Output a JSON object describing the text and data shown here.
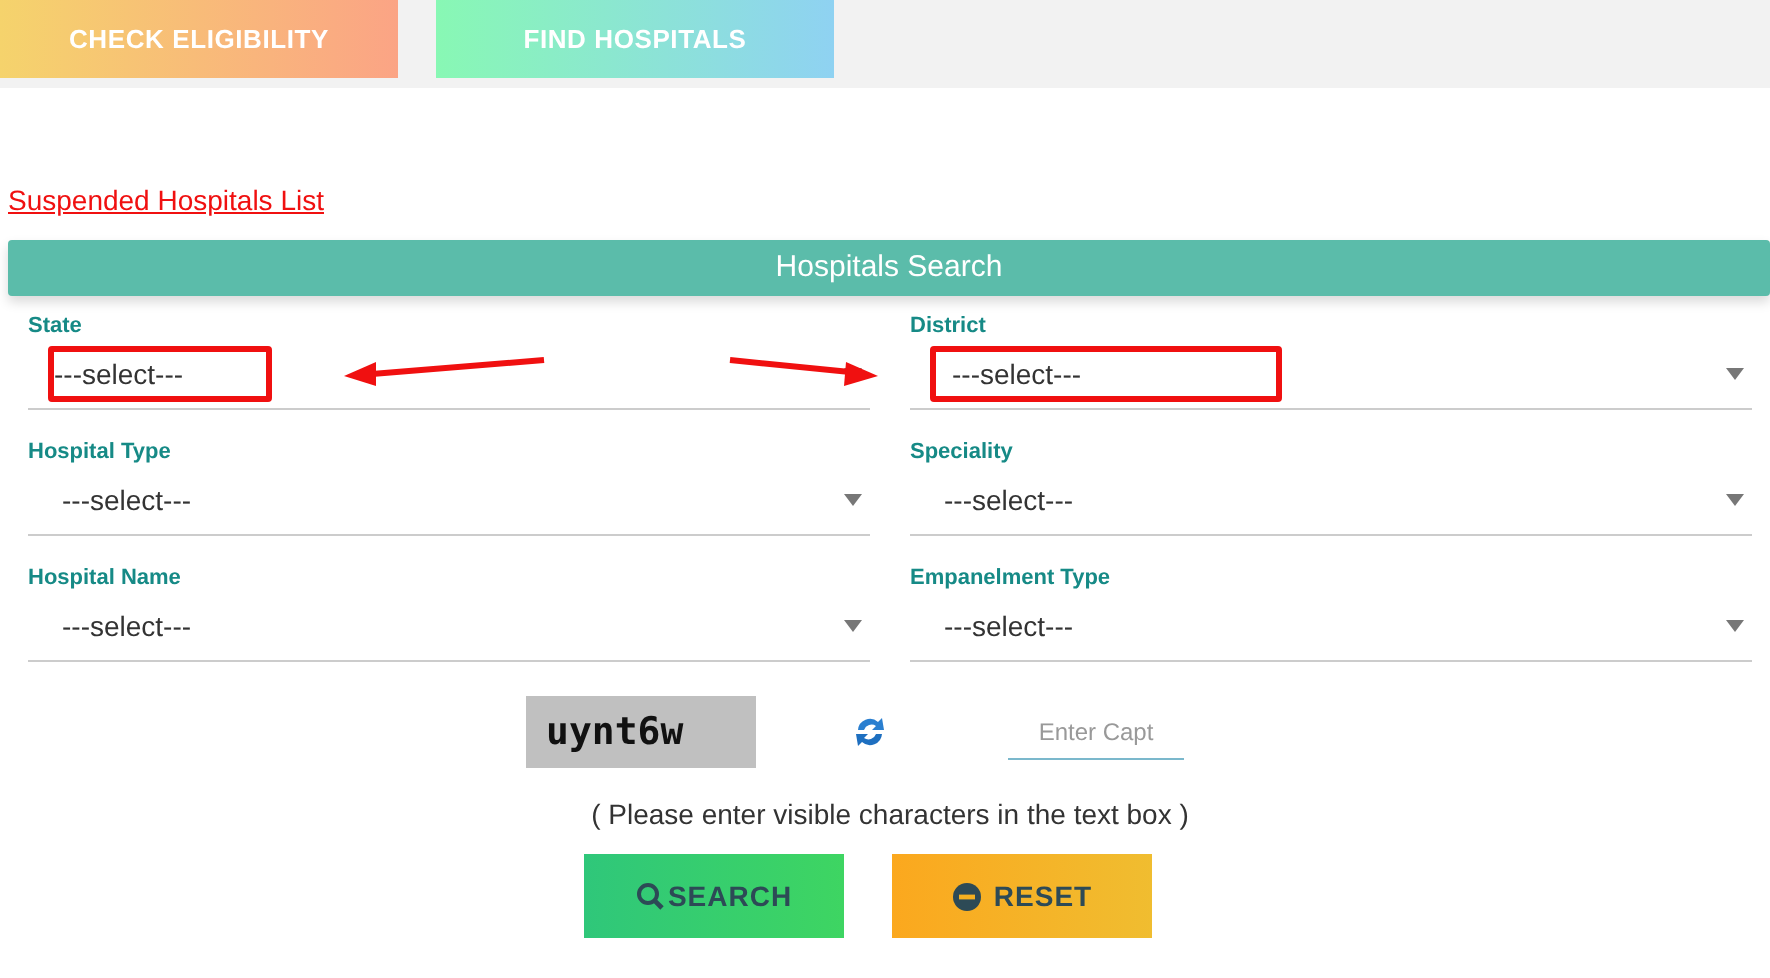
{
  "tabs": [
    {
      "label": "CHECK ELIGIBILITY",
      "kind": "warm"
    },
    {
      "label": "FIND HOSPITALS",
      "kind": "cool"
    }
  ],
  "link": "Suspended Hospitals List",
  "panel_title": "Hospitals Search",
  "fields": [
    {
      "label": "State",
      "value": "---select---",
      "highlighted": true
    },
    {
      "label": "District",
      "value": "---select---",
      "highlighted": true
    },
    {
      "label": "Hospital Type",
      "value": "---select---",
      "highlighted": false
    },
    {
      "label": "Speciality",
      "value": "---select---",
      "highlighted": false
    },
    {
      "label": "Hospital Name",
      "value": "---select---",
      "highlighted": false
    },
    {
      "label": "Empanelment Type",
      "value": "---select---",
      "highlighted": false
    }
  ],
  "captcha": {
    "code": "uynt6w",
    "placeholder": "Enter Capt"
  },
  "hint": "( Please enter visible characters in the text box )",
  "buttons": [
    {
      "label": "SEARCH",
      "kind": "search"
    },
    {
      "label": "RESET",
      "kind": "reset"
    }
  ]
}
